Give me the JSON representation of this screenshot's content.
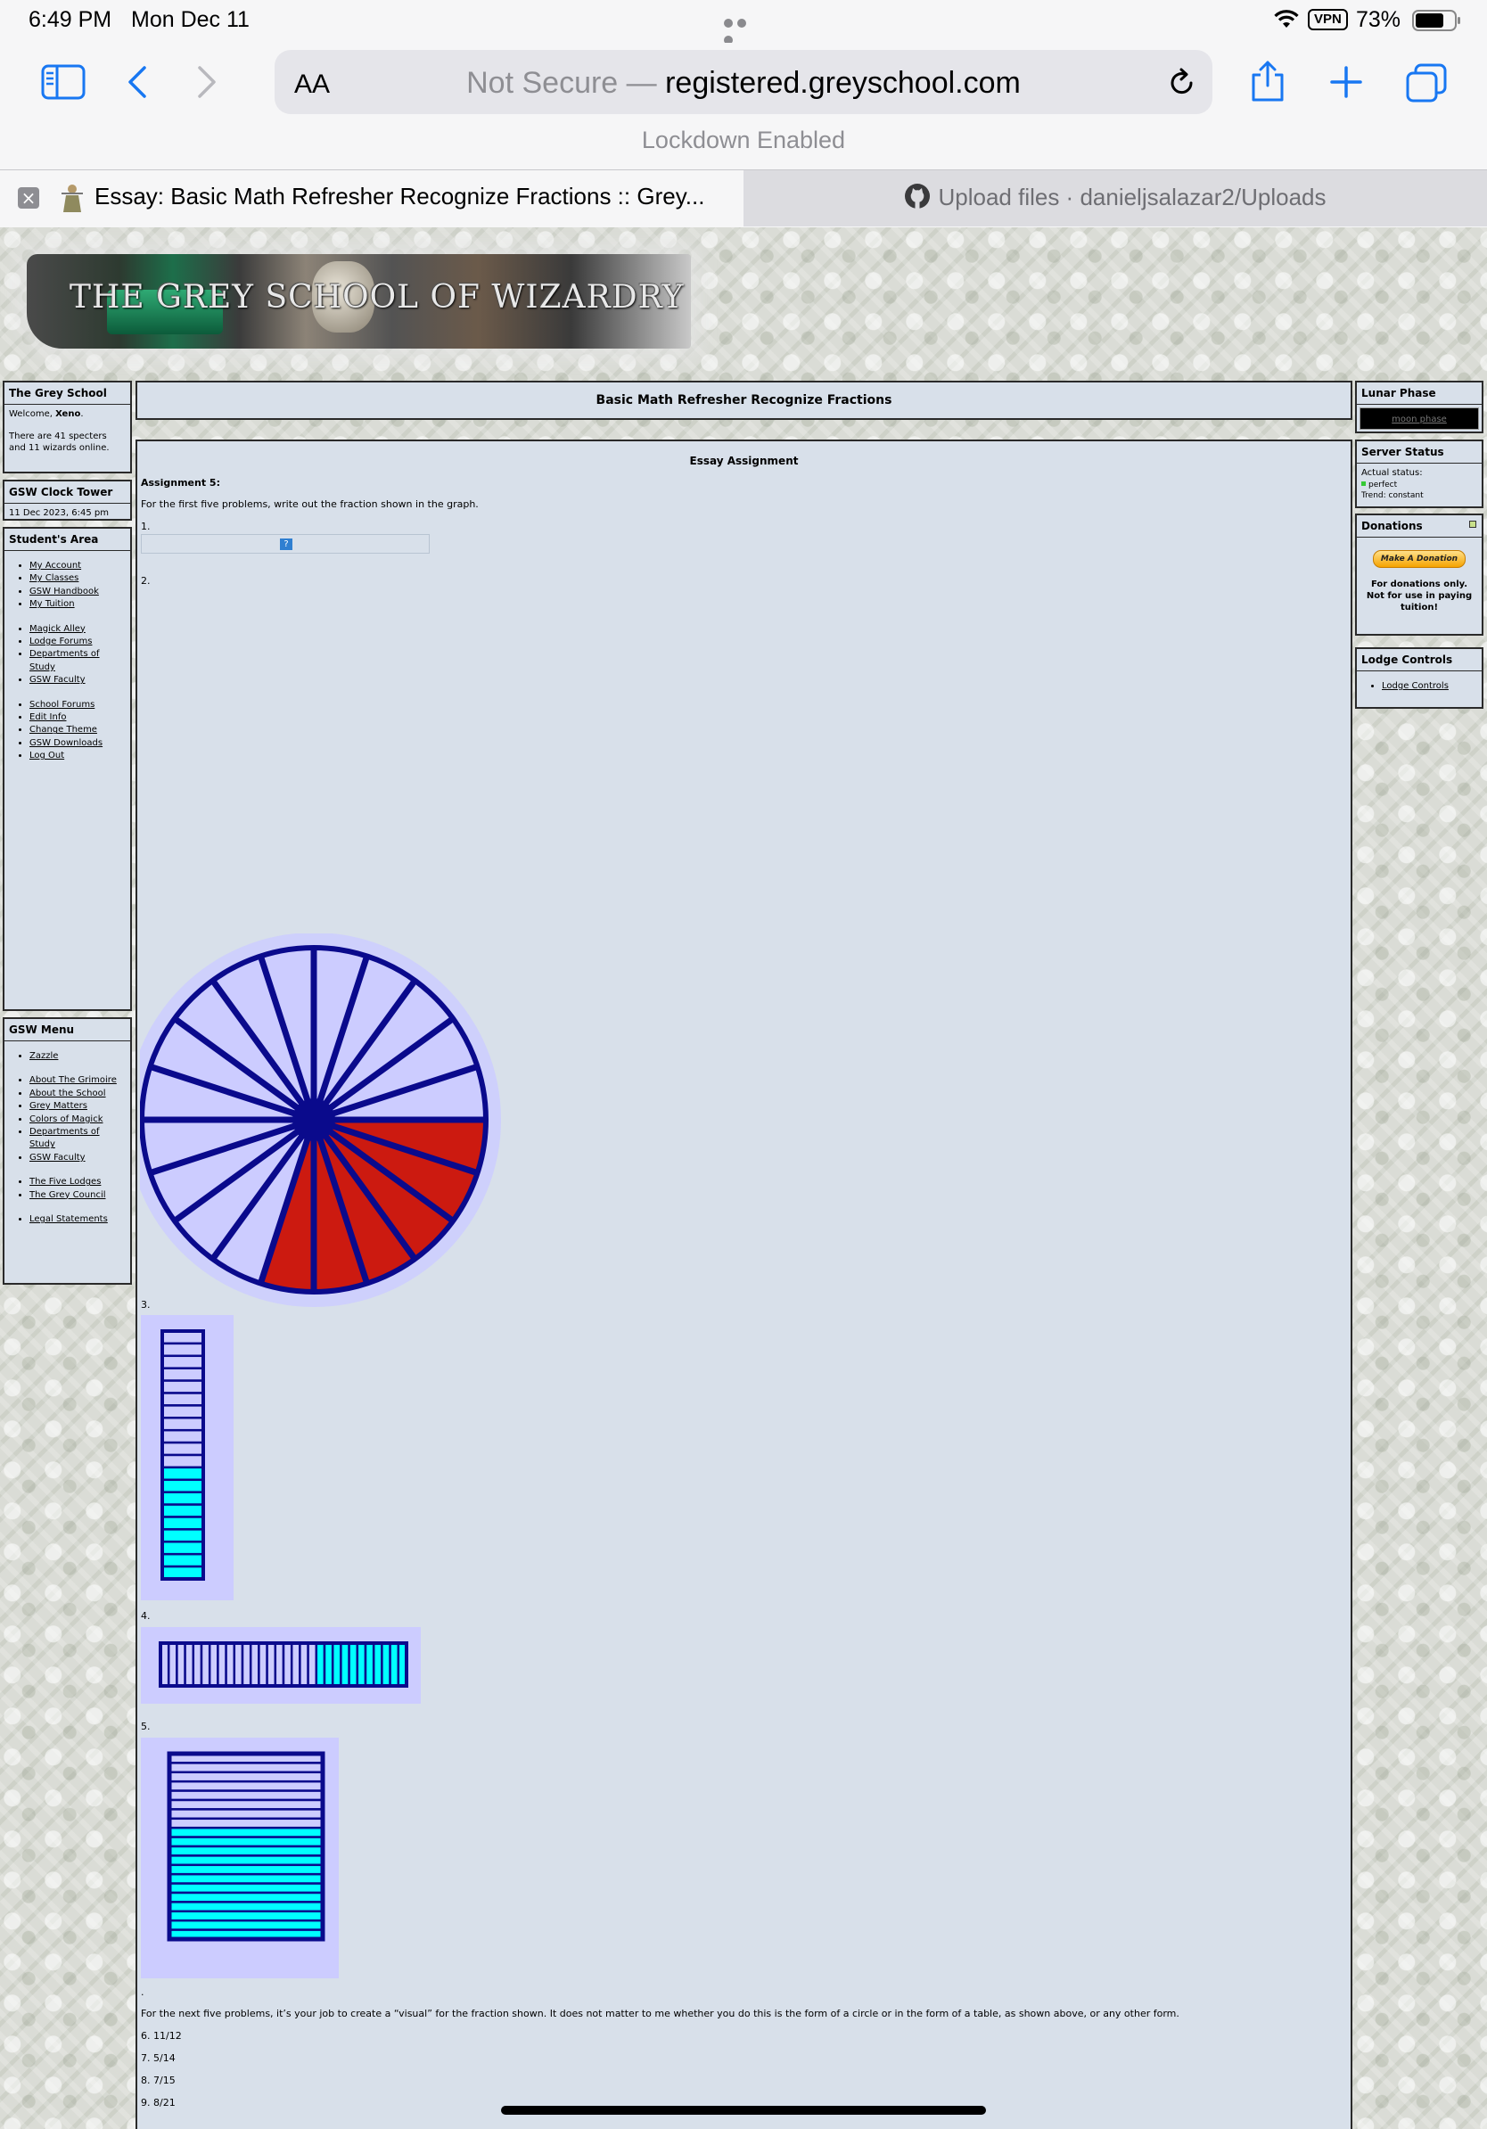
{
  "status_bar": {
    "time": "6:49 PM",
    "date": "Mon Dec 11",
    "vpn": "VPN",
    "battery": "73%"
  },
  "browser": {
    "text_size": "AA",
    "url_prefix": "Not Secure — ",
    "url_host": "registered.greyschool.com",
    "lockdown": "Lockdown Enabled",
    "tabs": [
      {
        "title": "Essay: Basic Math Refresher Recognize Fractions :: Grey...",
        "active": true
      },
      {
        "title": "Upload files · danieljsalazar2/Uploads",
        "active": false
      }
    ]
  },
  "banner": {
    "title": "THE GREY SCHOOL OF WIZARDRY"
  },
  "left": {
    "grey_school": {
      "title": "The Grey School",
      "welcome_pre": "Welcome, ",
      "user": "Xeno",
      "welcome_post": ".",
      "online": "There are 41 specters and 11 wizards online."
    },
    "clock": {
      "title": "GSW Clock Tower",
      "value": "11 Dec 2023, 6:45 pm"
    },
    "students_area": {
      "title": "Student's Area",
      "group1": [
        "My Account",
        "My Classes",
        "GSW Handbook",
        "My Tuition"
      ],
      "group2": [
        "Magick Alley",
        "Lodge Forums",
        "Departments of Study",
        "GSW Faculty"
      ],
      "group3": [
        "School Forums",
        "Edit Info",
        "Change Theme",
        "GSW Downloads",
        "Log Out"
      ]
    },
    "gsw_menu": {
      "title": "GSW Menu",
      "group1": [
        "Zazzle"
      ],
      "group2": [
        "About The Grimoire",
        "About the School",
        "Grey Matters",
        "Colors of Magick",
        "Departments of Study",
        "GSW Faculty"
      ],
      "group3": [
        "The Five Lodges",
        "The Grey Council"
      ],
      "group4": [
        "Legal Statements"
      ]
    }
  },
  "right": {
    "lunar": {
      "title": "Lunar Phase",
      "alt": "moon phase"
    },
    "server": {
      "title": "Server Status",
      "actual": "Actual status:",
      "status": "perfect",
      "trend": "Trend: constant"
    },
    "donations": {
      "title": "Donations",
      "button": "Make A Donation",
      "note": "For donations only. Not for use in paying tuition!"
    },
    "lodge": {
      "title": "Lodge Controls",
      "item": "Lodge Controls"
    }
  },
  "main": {
    "title": "Basic Math Refresher Recognize Fractions",
    "essay_heading": "Essay Assignment",
    "assignment": "Assignment 5:",
    "intro": "For the first five problems, write out the fraction shown in the graph.",
    "problem_labels": [
      "1.",
      "2.",
      "3.",
      "4.",
      "5."
    ],
    "dot": ".",
    "next_intro": "For the next five problems, it’s your job to create a “visual” for the fraction shown. It does not matter to me whether you do this is the form of a circle or in the form of a table, as shown above, or any other form.",
    "fractions": [
      "6. 11/12",
      "7. 5/14",
      "8. 7/15",
      "9. 8/21"
    ]
  },
  "figures": {
    "circle": {
      "total_slices": 20,
      "shaded_slices": 6,
      "shade": "#cc1a10",
      "base": "#ccccff",
      "line": "#0a0a8c"
    },
    "column": {
      "total": 20,
      "shaded": 9,
      "shade": "#00ffff",
      "base": "#ccccff",
      "line": "#0a0a8c"
    },
    "row": {
      "total": 30,
      "shaded": 11,
      "shade": "#00ffff",
      "base": "#ccccff",
      "line": "#0a0a8c"
    },
    "table": {
      "total": 20,
      "shaded": 12,
      "shade": "#00ffff",
      "base": "#ccccff",
      "line": "#0a0a8c"
    }
  }
}
